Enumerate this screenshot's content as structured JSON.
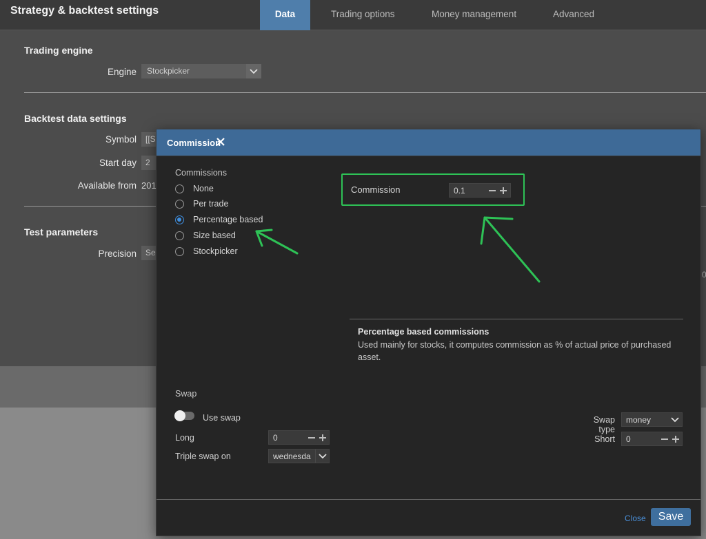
{
  "app": {
    "title": "Strategy & backtest settings",
    "tabs": [
      {
        "label": "Data",
        "active": true
      },
      {
        "label": "Trading options",
        "active": false
      },
      {
        "label": "Money management",
        "active": false
      },
      {
        "label": "Advanced",
        "active": false
      }
    ]
  },
  "settings": {
    "trading_engine": {
      "title": "Trading engine",
      "engine_label": "Engine",
      "engine_value": "Stockpicker"
    },
    "backtest_data": {
      "title": "Backtest data settings",
      "symbol_label": "Symbol",
      "symbol_value": "[[S",
      "start_day_label": "Start day",
      "start_day_value": "2",
      "available_from_label": "Available from",
      "available_from_value": "201"
    },
    "test_parameters": {
      "title": "Test parameters",
      "precision_label": "Precision",
      "precision_value": "Se"
    },
    "right_peek_text": "0"
  },
  "modal": {
    "title": "Commission",
    "commissions": {
      "group_label": "Commissions",
      "options": [
        {
          "label": "None",
          "selected": false
        },
        {
          "label": "Per trade",
          "selected": false
        },
        {
          "label": "Percentage based",
          "selected": true
        },
        {
          "label": "Size based",
          "selected": false
        },
        {
          "label": "Stockpicker",
          "selected": false
        }
      ]
    },
    "commission_field": {
      "label": "Commission",
      "value": "0.1"
    },
    "description": {
      "title": "Percentage based commissions",
      "text": "Used mainly for stocks, it computes commission as % of actual price of purchased asset."
    },
    "swap": {
      "group_label": "Swap",
      "use_swap_label": "Use swap",
      "use_swap_on": false,
      "long_label": "Long",
      "long_value": "0",
      "triple_label": "Triple swap on",
      "triple_value": "wednesda",
      "swap_type_label": "Swap type",
      "swap_type_value": "money",
      "short_label": "Short",
      "short_value": "0"
    },
    "footer": {
      "close_label": "Close",
      "save_label": "Save"
    }
  },
  "colors": {
    "accent": "#3e6a97",
    "active_tab": "#4f7eab",
    "radio_selected": "#3f8fe0",
    "annotation": "#2ec256",
    "link": "#4a90d9"
  }
}
